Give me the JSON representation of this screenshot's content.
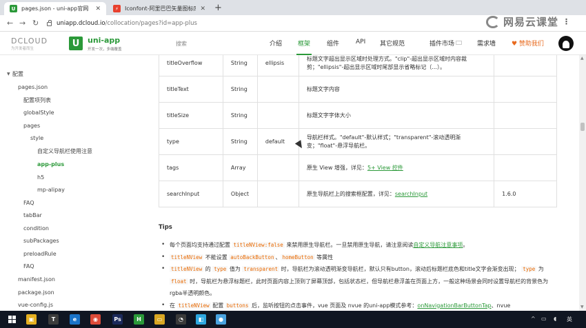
{
  "browser": {
    "tabs": [
      {
        "title": "pages.json - uni-app官网",
        "favicon": "U",
        "favicon_color": "#2b9939",
        "active": true
      },
      {
        "title": "Iconfont-阿里巴巴矢量图标库",
        "favicon": "⚡",
        "favicon_color": "#e8402d",
        "active": false
      }
    ],
    "new_tab": "+",
    "url_host": "uniapp.dcloud.io",
    "url_path": "/collocation/pages?id=app-plus",
    "watermark": "网易云课堂"
  },
  "site": {
    "dcloud_name": "DCLOUD",
    "dcloud_slogan": "为开发者而生",
    "uni_logo": "U",
    "uni_name": "uni-app",
    "uni_slogan": "开发一次，多端覆盖",
    "search_placeholder": "搜索",
    "nav": [
      "介绍",
      "框架",
      "组件",
      "API",
      "其它规范",
      "插件市场",
      "需求墙"
    ],
    "nav_active": "框架",
    "sponsor": "♥ 赞助我们",
    "brand_color": "#2b9939"
  },
  "sidebar": [
    {
      "label": "配置",
      "level": 0
    },
    {
      "label": "pages.json",
      "level": 1
    },
    {
      "label": "配置项列表",
      "level": 2
    },
    {
      "label": "globalStyle",
      "level": 2
    },
    {
      "label": "pages",
      "level": 2
    },
    {
      "label": "style",
      "level": 3
    },
    {
      "label": "自定义导航栏使用注意",
      "level": 4
    },
    {
      "label": "app-plus",
      "level": 4,
      "active": true
    },
    {
      "label": "h5",
      "level": 4
    },
    {
      "label": "mp-alipay",
      "level": 4
    },
    {
      "label": "FAQ",
      "level": 2
    },
    {
      "label": "tabBar",
      "level": 2
    },
    {
      "label": "condition",
      "level": 2
    },
    {
      "label": "subPackages",
      "level": 2
    },
    {
      "label": "preloadRule",
      "level": 2
    },
    {
      "label": "FAQ",
      "level": 2
    },
    {
      "label": "manifest.json",
      "level": 1
    },
    {
      "label": "package.json",
      "level": 1
    },
    {
      "label": "vue-config.js",
      "level": 1
    }
  ],
  "table_rows": [
    {
      "name": "titleOverflow",
      "type": "String",
      "default": "ellipsis",
      "desc": "标题文字超出显示区域时处理方式。\"clip\"-超出显示区域时内容裁剪；\"ellipsis\"-超出显示区域时尾部显示省略标记（...）。",
      "link": "",
      "version": ""
    },
    {
      "name": "titleText",
      "type": "String",
      "default": "",
      "desc": "标题文字内容",
      "link": "",
      "version": ""
    },
    {
      "name": "titleSize",
      "type": "String",
      "default": "",
      "desc": "标题文字字体大小",
      "link": "",
      "version": ""
    },
    {
      "name": "type",
      "type": "String",
      "default": "default",
      "desc": "导航栏样式。\"default\"-默认样式；\"transparent\"-滚动透明渐变；\"float\"-悬浮导航栏。",
      "link": "",
      "version": ""
    },
    {
      "name": "tags",
      "type": "Array",
      "default": "",
      "desc": "原生 View 增强，详见：",
      "link": "5+ View 控件",
      "version": ""
    },
    {
      "name": "searchInput",
      "type": "Object",
      "default": "",
      "desc": "原生导航栏上的搜索框配置，详见：",
      "link": "searchInput",
      "version": "1.6.0"
    }
  ],
  "tips": {
    "title": "Tips",
    "item1": {
      "a": "每个页面均支持通过配置 ",
      "code1": "titleNView:false",
      "b": " 来禁用原生导航栏。一旦禁用原生导航，请注意阅读",
      "link": "自定义导航注意事项",
      "c": "。"
    },
    "item2": {
      "code1": "titleNView",
      "a": " 不能设置 ",
      "code2": "autoBackButton",
      "b": "、",
      "code3": "homeButton",
      "c": " 等属性"
    },
    "item3": {
      "code1": "titleNView",
      "a": " 的 ",
      "code2": "type",
      "b": " 值为 ",
      "code3": "transparent",
      "c": " 时，导航栏为滚动透明渐变导航栏，默认只有button，滚动后标题栏底色和title文字会渐变出现； ",
      "code4": "type",
      "d": " 为 ",
      "code5": "float",
      "e": " 时，导航栏为悬浮标题栏，此时页面内容上顶到了屏幕顶部，包括状态栏，但导航栏悬浮盖在页面上方，一般这种场景会同时设置导航栏的背景色为rgba半透明颜色。"
    },
    "item4": {
      "a": "在 ",
      "code1": "titleNView",
      "b": " 配置 ",
      "code2": "buttons",
      "c": " 后，监听按钮的点击事件，vue 页面及 nvue 的uni-app模式参考：",
      "link": "onNavigationBarButtonTap",
      "d": "、nvue"
    }
  },
  "taskbar": {
    "icons": [
      {
        "name": "files-icon",
        "glyph": "▣",
        "color": "#e6b021"
      },
      {
        "name": "typora-icon",
        "glyph": "T",
        "color": "#3c3c3c"
      },
      {
        "name": "edge-icon",
        "glyph": "e",
        "color": "#1a73c8"
      },
      {
        "name": "chrome-icon",
        "glyph": "◉",
        "color": "#dd4b39"
      },
      {
        "name": "photoshop-icon",
        "glyph": "Ps",
        "color": "#1c2a5b"
      },
      {
        "name": "hbuilder-icon",
        "glyph": "H",
        "color": "#2b9939"
      },
      {
        "name": "folder-icon",
        "glyph": "▭",
        "color": "#d9a723"
      },
      {
        "name": "wechat-devtools-icon",
        "glyph": "◔",
        "color": "#3a3a3a"
      },
      {
        "name": "app-icon",
        "glyph": "◧",
        "color": "#2ea7df"
      },
      {
        "name": "record-icon",
        "glyph": "●",
        "color": "#4aa3df"
      }
    ],
    "tray_text": "英"
  }
}
